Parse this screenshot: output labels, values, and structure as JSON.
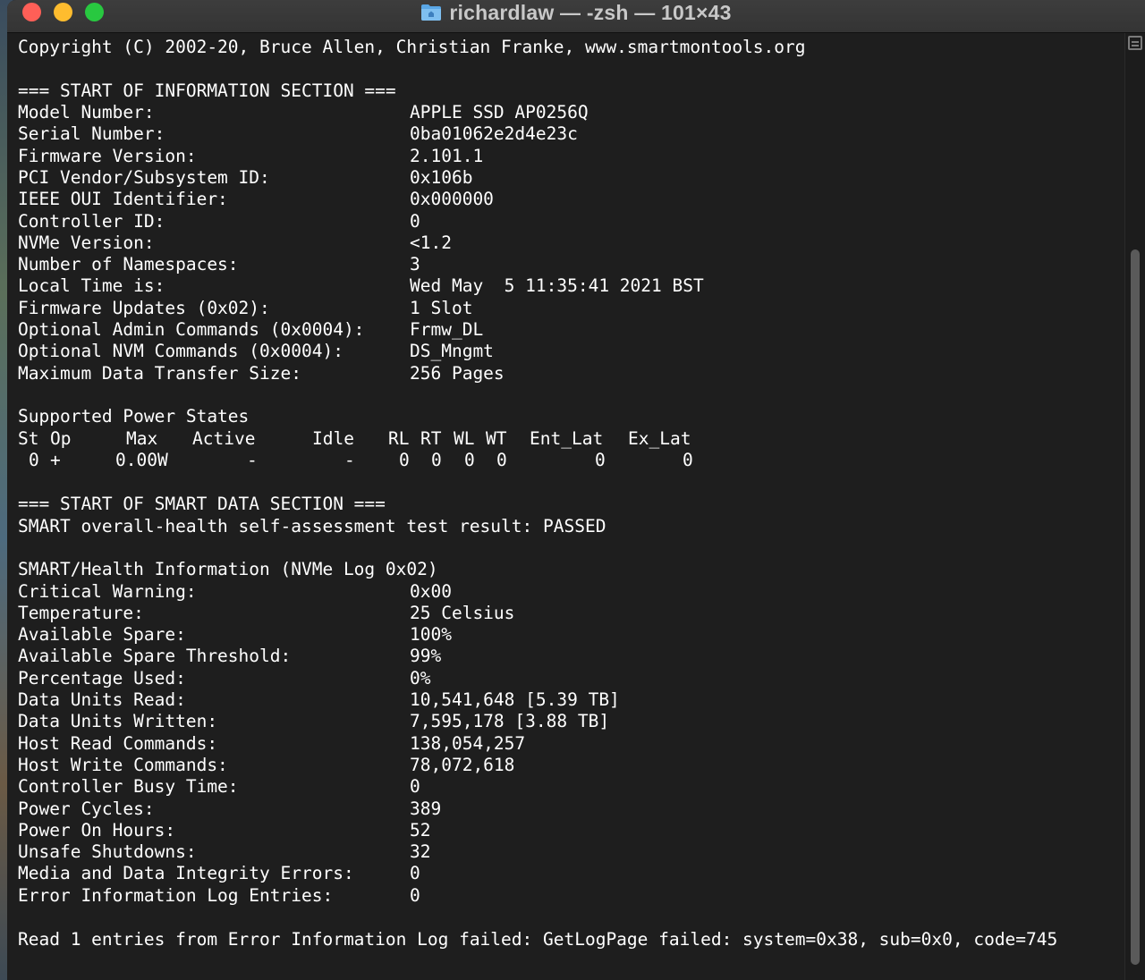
{
  "window": {
    "title": "richardlaw — -zsh — 101×43"
  },
  "terminal": {
    "copyright": "Copyright (C) 2002-20, Bruce Allen, Christian Franke, www.smartmontools.org",
    "info_section_header": "=== START OF INFORMATION SECTION ===",
    "info": [
      {
        "label": "Model Number:",
        "value": "APPLE SSD AP0256Q"
      },
      {
        "label": "Serial Number:",
        "value": "0ba01062e2d4e23c"
      },
      {
        "label": "Firmware Version:",
        "value": "2.101.1"
      },
      {
        "label": "PCI Vendor/Subsystem ID:",
        "value": "0x106b"
      },
      {
        "label": "IEEE OUI Identifier:",
        "value": "0x000000"
      },
      {
        "label": "Controller ID:",
        "value": "0"
      },
      {
        "label": "NVMe Version:",
        "value": "<1.2"
      },
      {
        "label": "Number of Namespaces:",
        "value": "3"
      },
      {
        "label": "Local Time is:",
        "value": "Wed May  5 11:35:41 2021 BST"
      },
      {
        "label": "Firmware Updates (0x02):",
        "value": "1 Slot"
      },
      {
        "label": "Optional Admin Commands (0x0004):",
        "value": "Frmw_DL"
      },
      {
        "label": "Optional NVM Commands (0x0004):",
        "value": "DS_Mngmt"
      },
      {
        "label": "Maximum Data Transfer Size:",
        "value": "256 Pages"
      }
    ],
    "power_states": {
      "title": "Supported Power States",
      "headers": [
        "St",
        "Op",
        "Max",
        "Active",
        "Idle",
        "RL",
        "RT",
        "WL",
        "WT",
        "Ent_Lat",
        "Ex_Lat"
      ],
      "rows": [
        [
          "0",
          "+",
          "0.00W",
          "-",
          "-",
          "0",
          "0",
          "0",
          "0",
          "0",
          "0"
        ]
      ]
    },
    "smart_section_header": "=== START OF SMART DATA SECTION ===",
    "health_result": "SMART overall-health self-assessment test result: PASSED",
    "health_title": "SMART/Health Information (NVMe Log 0x02)",
    "health": [
      {
        "label": "Critical Warning:",
        "value": "0x00"
      },
      {
        "label": "Temperature:",
        "value": "25 Celsius"
      },
      {
        "label": "Available Spare:",
        "value": "100%"
      },
      {
        "label": "Available Spare Threshold:",
        "value": "99%"
      },
      {
        "label": "Percentage Used:",
        "value": "0%"
      },
      {
        "label": "Data Units Read:",
        "value": "10,541,648 [5.39 TB]"
      },
      {
        "label": "Data Units Written:",
        "value": "7,595,178 [3.88 TB]"
      },
      {
        "label": "Host Read Commands:",
        "value": "138,054,257"
      },
      {
        "label": "Host Write Commands:",
        "value": "78,072,618"
      },
      {
        "label": "Controller Busy Time:",
        "value": "0"
      },
      {
        "label": "Power Cycles:",
        "value": "389"
      },
      {
        "label": "Power On Hours:",
        "value": "52"
      },
      {
        "label": "Unsafe Shutdowns:",
        "value": "32"
      },
      {
        "label": "Media and Data Integrity Errors:",
        "value": "0"
      },
      {
        "label": "Error Information Log Entries:",
        "value": "0"
      }
    ],
    "error_line": "Read 1 entries from Error Information Log failed: GetLogPage failed: system=0x38, sub=0x0, code=745"
  }
}
